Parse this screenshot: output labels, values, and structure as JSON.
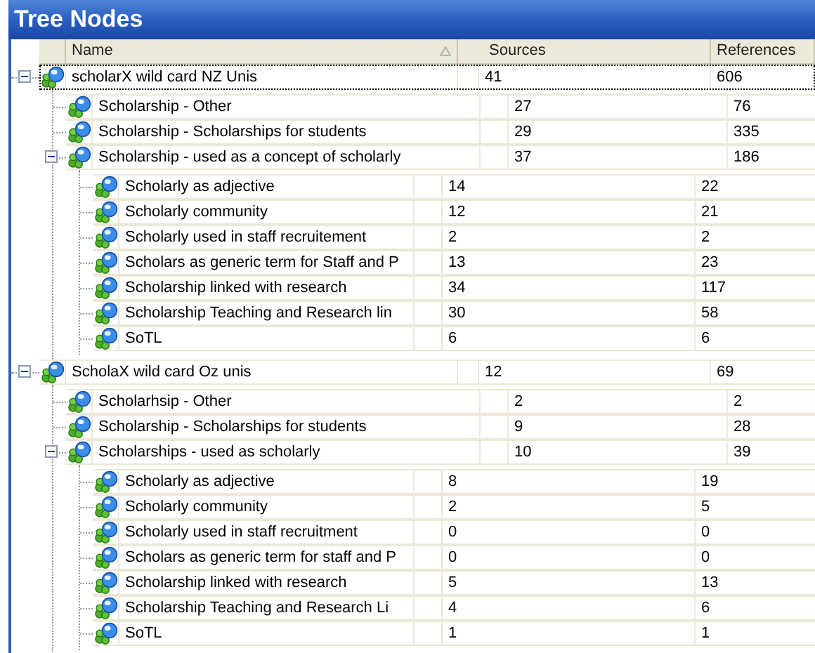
{
  "panel": {
    "title": "Tree Nodes"
  },
  "columns": [
    {
      "label": "Name",
      "sorted": true
    },
    {
      "label": "Sources",
      "sorted": false
    },
    {
      "label": "References",
      "sorted": false
    }
  ],
  "nodes": [
    {
      "name": "scholarX wild card NZ Unis",
      "sources": "41",
      "references": "606",
      "selected": true,
      "expanded": true,
      "children": [
        {
          "name": "Scholarship - Other",
          "sources": "27",
          "references": "76",
          "selected": false
        },
        {
          "name": "Scholarship - Scholarships for students",
          "sources": "29",
          "references": "335",
          "selected": false
        },
        {
          "name": "Scholarship - used as a concept of scholarly",
          "sources": "37",
          "references": "186",
          "selected": false,
          "expanded": true,
          "children": [
            {
              "name": "Scholarly as adjective",
              "sources": "14",
              "references": "22",
              "selected": false
            },
            {
              "name": "Scholarly community",
              "sources": "12",
              "references": "21",
              "selected": false
            },
            {
              "name": "Scholarly used in staff recruitement",
              "sources": "2",
              "references": "2",
              "selected": false
            },
            {
              "name": "Scholars as generic term for Staff and P",
              "sources": "13",
              "references": "23",
              "selected": false
            },
            {
              "name": "Scholarship linked with research",
              "sources": "34",
              "references": "117",
              "selected": false
            },
            {
              "name": "Scholarship Teaching and Research lin",
              "sources": "30",
              "references": "58",
              "selected": false
            },
            {
              "name": "SoTL",
              "sources": "6",
              "references": "6",
              "selected": false
            }
          ]
        }
      ]
    },
    {
      "name": "ScholaX wild card Oz unis",
      "sources": "12",
      "references": "69",
      "selected": false,
      "expanded": true,
      "children": [
        {
          "name": "Scholarhsip - Other",
          "sources": "2",
          "references": "2",
          "selected": false
        },
        {
          "name": "Scholarship - Scholarships for students",
          "sources": "9",
          "references": "28",
          "selected": false
        },
        {
          "name": "Scholarships - used as scholarly",
          "sources": "10",
          "references": "39",
          "selected": false,
          "expanded": true,
          "children": [
            {
              "name": "Scholarly as adjective",
              "sources": "8",
              "references": "19",
              "selected": false
            },
            {
              "name": "Scholarly community",
              "sources": "2",
              "references": "5",
              "selected": false
            },
            {
              "name": "Scholarly used in staff recruitment",
              "sources": "0",
              "references": "0",
              "selected": false
            },
            {
              "name": "Scholars as generic term for staff and P",
              "sources": "0",
              "references": "0",
              "selected": false
            },
            {
              "name": "Scholarship linked with research",
              "sources": "5",
              "references": "13",
              "selected": false
            },
            {
              "name": "Scholarship Teaching and Research Li",
              "sources": "4",
              "references": "6",
              "selected": false
            },
            {
              "name": "SoTL",
              "sources": "1",
              "references": "1",
              "selected": false
            }
          ]
        }
      ]
    }
  ]
}
